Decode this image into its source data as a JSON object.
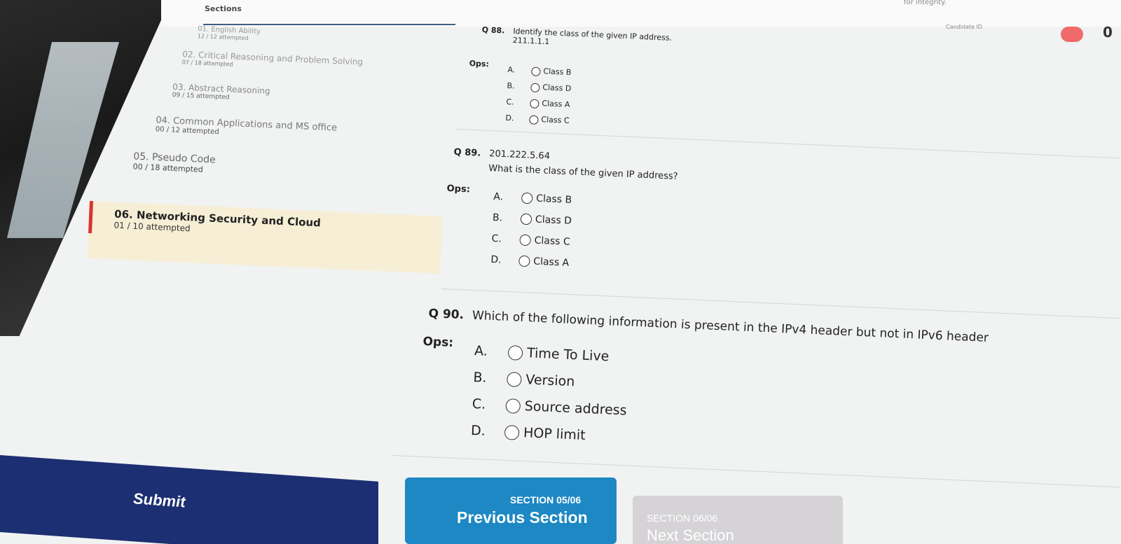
{
  "header": {
    "sections_title": "Sections",
    "integrity_text": "for integrity.",
    "candidate_label": "Candidate ID",
    "candidate_id": "",
    "timer": ""
  },
  "sections": [
    {
      "name": "01. English Ability",
      "count": "12 / 12 attempted"
    },
    {
      "name": "02. Critical Reasoning and Problem Solving",
      "count": "07 / 18 attempted"
    },
    {
      "name": "03. Abstract Reasoning",
      "count": "09 / 15 attempted"
    },
    {
      "name": "04. Common Applications and MS office",
      "count": "00 / 12 attempted"
    },
    {
      "name": "05. Pseudo Code",
      "count": "00 / 18 attempted"
    },
    {
      "name": "06. Networking Security and Cloud",
      "count": "01 / 10 attempted"
    }
  ],
  "questions": [
    {
      "num": "Q 88.",
      "text": "Identify the class of the given IP address.",
      "subtext": "211.1.1.1",
      "ops_label": "Ops:",
      "options": [
        {
          "letter": "A.",
          "text": "Class B"
        },
        {
          "letter": "B.",
          "text": "Class D"
        },
        {
          "letter": "C.",
          "text": "Class A"
        },
        {
          "letter": "D.",
          "text": "Class C"
        }
      ]
    },
    {
      "num": "Q 89.",
      "text": "201.222.5.64",
      "subtext": "What is the class of the given IP address?",
      "ops_label": "Ops:",
      "options": [
        {
          "letter": "A.",
          "text": "Class B"
        },
        {
          "letter": "B.",
          "text": "Class D"
        },
        {
          "letter": "C.",
          "text": "Class C"
        },
        {
          "letter": "D.",
          "text": "Class A"
        }
      ]
    },
    {
      "num": "Q 90.",
      "text": "Which of the following information is present in the IPv4 header but not in IPv6 header",
      "ops_label": "Ops:",
      "options": [
        {
          "letter": "A.",
          "text": "Time To Live"
        },
        {
          "letter": "B.",
          "text": "Version"
        },
        {
          "letter": "C.",
          "text": "Source address"
        },
        {
          "letter": "D.",
          "text": "HOP limit"
        }
      ]
    }
  ],
  "footer": {
    "submit_label": "Submit",
    "prev_section_label": "SECTION 05/06",
    "prev_button_label": "Previous Section",
    "next_section_label": "SECTION 06/06",
    "next_button_label": "Next Section"
  },
  "colors": {
    "submit_bg": "#1c2f72",
    "prev_bg": "#1d88c4",
    "next_bg": "#d5d3d6",
    "active_section_bg": "#f6efd6",
    "active_marker": "#d9342b"
  }
}
